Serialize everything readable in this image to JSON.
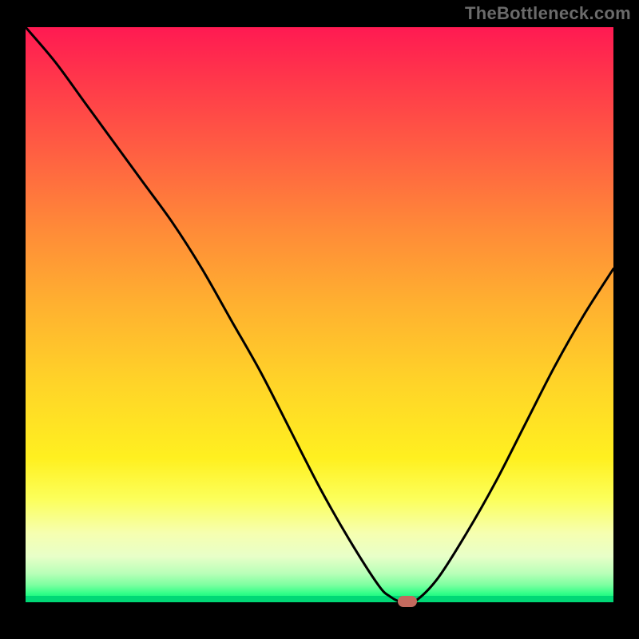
{
  "watermark": "TheBottleneck.com",
  "chart_data": {
    "type": "line",
    "title": "",
    "xlabel": "",
    "ylabel": "",
    "xlim": [
      0,
      100
    ],
    "ylim": [
      0,
      100
    ],
    "x": [
      0,
      5,
      10,
      15,
      20,
      25,
      30,
      35,
      40,
      45,
      50,
      55,
      60,
      62,
      64,
      66,
      70,
      75,
      80,
      85,
      90,
      95,
      100
    ],
    "values": [
      100,
      94,
      87,
      80,
      73,
      66,
      58,
      49,
      40,
      30,
      20,
      11,
      3,
      1,
      0,
      0,
      4,
      12,
      21,
      31,
      41,
      50,
      58
    ],
    "background": "rainbow-vertical-gradient",
    "marker": {
      "x": 65,
      "y": 0
    }
  },
  "colors": {
    "curve": "#000000",
    "marker": "#c36a5e",
    "frame": "#000000"
  }
}
